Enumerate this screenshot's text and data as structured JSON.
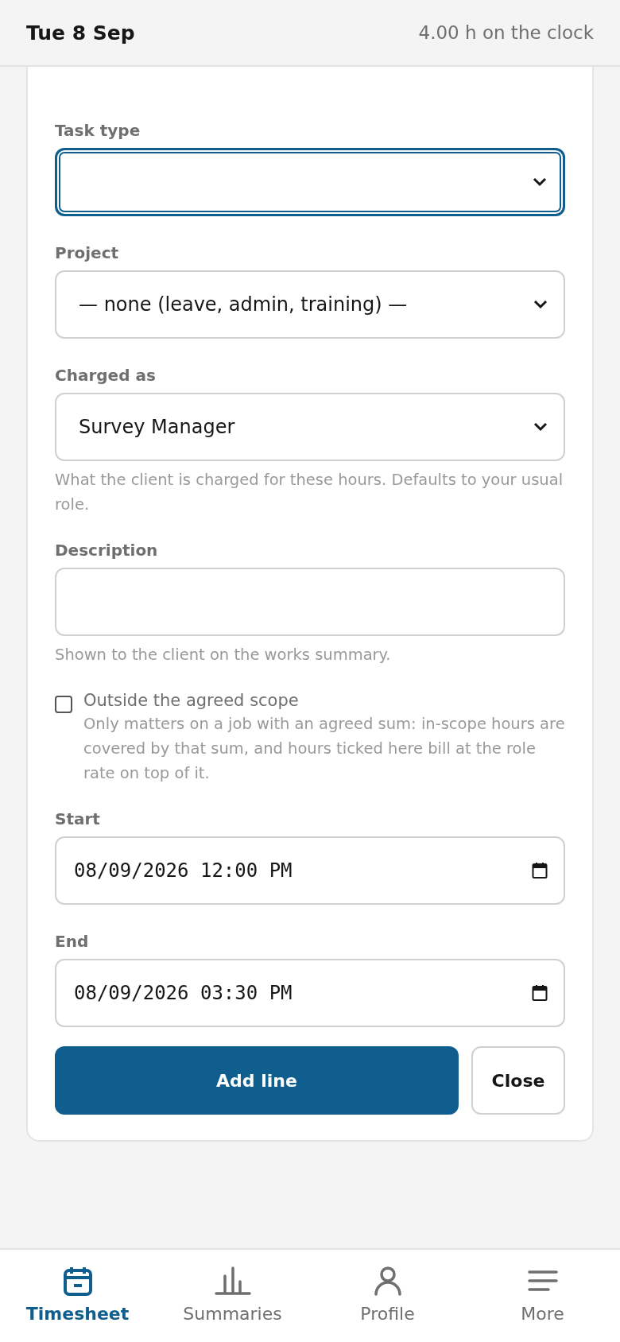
{
  "header": {
    "title": "Tue 8 Sep",
    "hours": "4.00 h on the clock"
  },
  "form": {
    "fields": [
      {
        "kind": "select",
        "label": "Task type",
        "focused": true
      },
      {
        "kind": "select",
        "label": "Project",
        "value": "— none (leave, admin, training) —",
        "focused": false
      },
      {
        "kind": "select",
        "label": "Charged as",
        "value": "Survey Manager",
        "focused": false,
        "help": "What the client is charged for these hours. Defaults to your usual role."
      },
      {
        "kind": "text",
        "label": "Description",
        "focused": false,
        "help": "Shown to the client on the works summary."
      },
      {
        "kind": "checkbox",
        "label": "Outside the agreed scope",
        "checked": false,
        "help": "Only matters on a job with an agreed sum: in-scope hours are covered by that sum, and hours ticked here bill at the role rate on top of it."
      },
      {
        "kind": "datetime",
        "label": "Start",
        "value": "08/09/2026 12:00 PM",
        "focused": false
      },
      {
        "kind": "datetime",
        "label": "End",
        "value": "08/09/2026 03:30 PM",
        "focused": false
      }
    ],
    "buttons": [
      {
        "label": "Add line",
        "kind": "primary"
      },
      {
        "label": "Close",
        "kind": "secondary"
      }
    ]
  },
  "nav": [
    {
      "label": "Timesheet",
      "kind": "calendar",
      "selected": true
    },
    {
      "label": "Summaries",
      "kind": "chart",
      "selected": false
    },
    {
      "label": "Profile",
      "kind": "person",
      "selected": false
    },
    {
      "label": "More",
      "kind": "menu",
      "selected": false
    }
  ]
}
